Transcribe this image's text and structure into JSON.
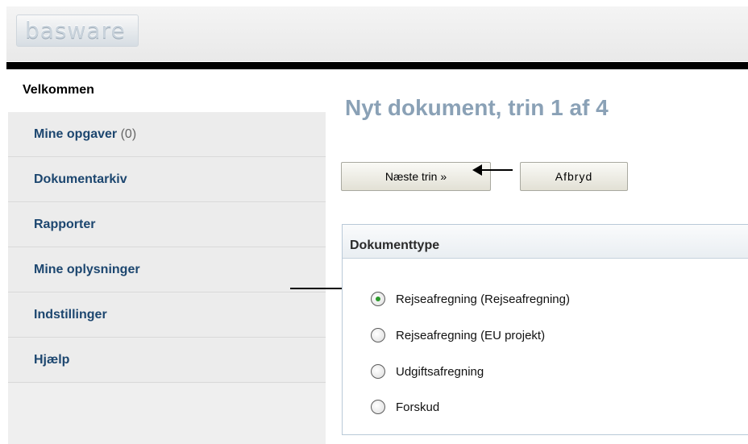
{
  "header": {
    "logo_text": "basware"
  },
  "sidebar": {
    "welcome_label": "Velkommen",
    "items": [
      {
        "label": "Mine opgaver",
        "count": "(0)"
      },
      {
        "label": "Dokumentarkiv"
      },
      {
        "label": "Rapporter"
      },
      {
        "label": "Mine oplysninger"
      },
      {
        "label": "Indstillinger"
      },
      {
        "label": "Hjælp"
      }
    ]
  },
  "main": {
    "title": "Nyt dokument, trin 1 af 4",
    "next_button": "Næste trin »",
    "cancel_button": "Afbryd",
    "panel": {
      "title": "Dokumenttype",
      "options": [
        {
          "label": "Rejseafregning (Rejseafregning)",
          "selected": true
        },
        {
          "label": "Rejseafregning (EU projekt)",
          "selected": false
        },
        {
          "label": "Udgiftsafregning",
          "selected": false
        },
        {
          "label": "Forskud",
          "selected": false
        }
      ]
    }
  },
  "colors": {
    "nav_text": "#1c466f",
    "title_text": "#8aa1b6",
    "radio_selected": "#2c9a2c"
  }
}
